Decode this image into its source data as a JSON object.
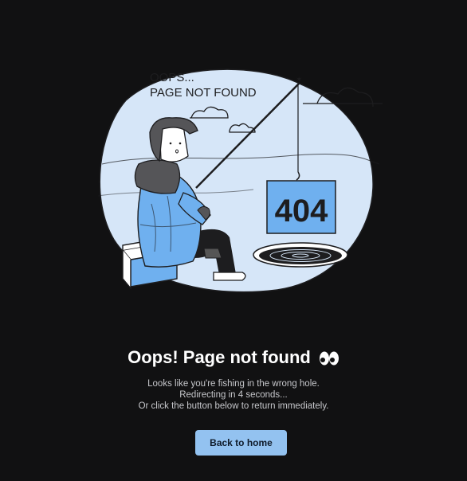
{
  "illustration": {
    "bubble_text_line1": "OOPS...",
    "bubble_text_line2": "PAGE NOT FOUND",
    "sign_text": "404"
  },
  "heading": {
    "title": "Oops! Page not found",
    "emoji_icon": "eyes-icon"
  },
  "message": {
    "line1": "Looks like you're fishing in the wrong hole.",
    "line2": "Redirecting in 4 seconds...",
    "line3": "Or click the button below to return immediately."
  },
  "actions": {
    "home_button_label": "Back to home"
  },
  "colors": {
    "background": "#111112",
    "accent": "#93c2f0",
    "blob": "#d6e6f8",
    "dark": "#1d1d1f"
  }
}
